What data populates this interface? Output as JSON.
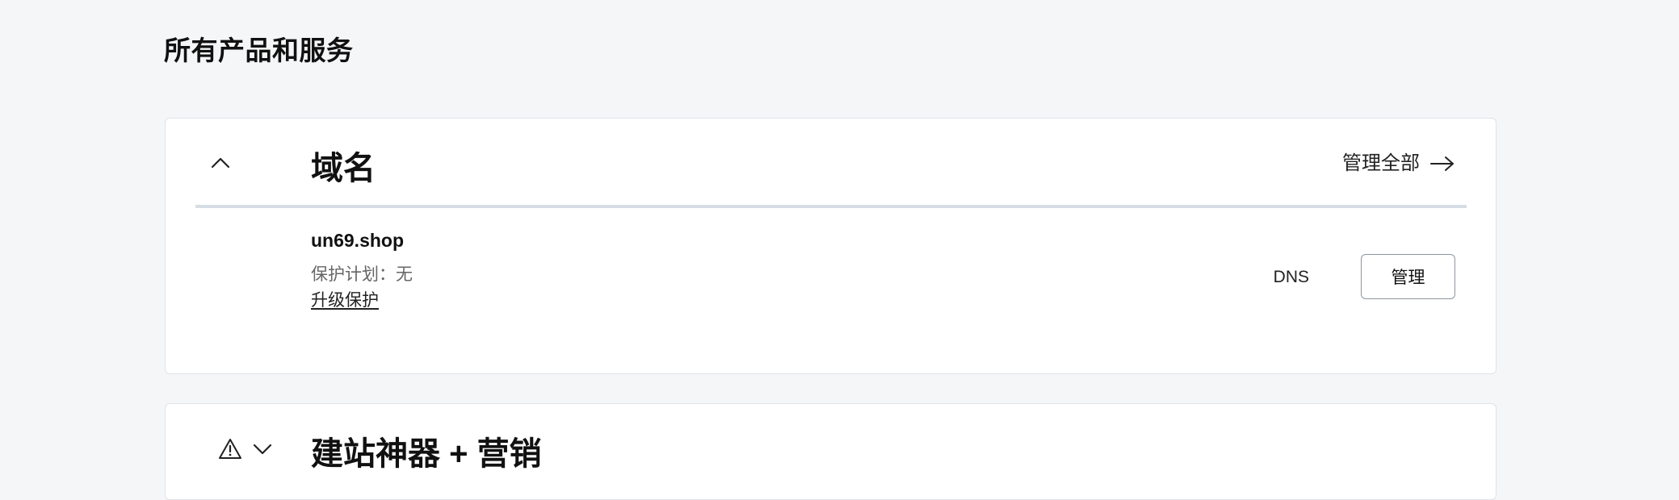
{
  "page": {
    "title": "所有产品和服务"
  },
  "domains_section": {
    "title": "域名",
    "manage_all_label": "管理全部",
    "collapse_icon": "chevron-up-icon",
    "arrow_icon": "arrow-right-icon",
    "item": {
      "domain": "un69.shop",
      "protection_label": "保护计划：无",
      "upgrade_label": "升级保护",
      "dns_label": "DNS",
      "manage_label": "管理"
    }
  },
  "builder_section": {
    "title": "建站神器 + 营销",
    "warning_icon": "warning-triangle-icon",
    "expand_icon": "chevron-down-icon"
  },
  "colors": {
    "background": "#f5f6f8",
    "card": "#ffffff",
    "divider": "#d7dde4",
    "text_primary": "#111111",
    "text_muted": "#666666"
  }
}
